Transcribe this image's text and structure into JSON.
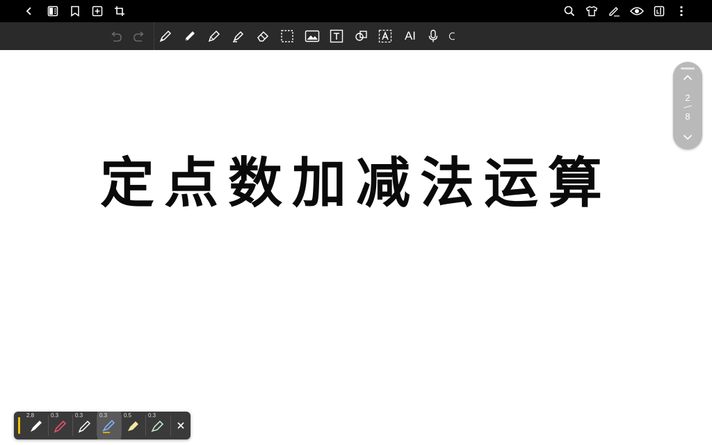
{
  "title": "定点数加减法运算",
  "pager": {
    "current": "2",
    "total": "8"
  },
  "pens": [
    {
      "size": "2.8",
      "name": "fountain-pen",
      "color": "#ffffff"
    },
    {
      "size": "0.3",
      "name": "ballpoint-pen",
      "color": "#e8506a"
    },
    {
      "size": "0.3",
      "name": "pencil",
      "color": "#ffffff"
    },
    {
      "size": "0.3",
      "name": "brush-pen",
      "color": "#7fb2ff"
    },
    {
      "size": "0.5",
      "name": "highlighter",
      "color": "#f4e9a0"
    },
    {
      "size": "0.3",
      "name": "marker",
      "color": "#bfe6c8"
    }
  ],
  "toolbar": {
    "ai_label": "AI"
  },
  "colors": {
    "topbar": "#000000",
    "toolbar": "#2a2a2a",
    "pager": "#b9b9b9",
    "tray": "#3a3a3a",
    "accent": "#f2c200"
  }
}
